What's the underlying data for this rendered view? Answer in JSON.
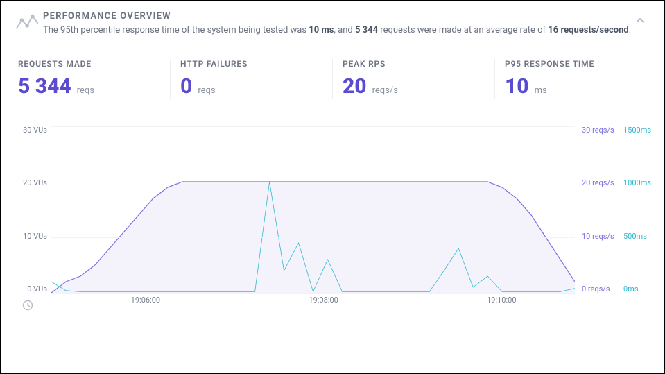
{
  "header": {
    "title": "PERFORMANCE OVERVIEW",
    "subtitle_prefix": "The 95th percentile response time of the system being tested was ",
    "p95_inline": "10 ms",
    "subtitle_mid": ", and ",
    "reqs_inline": "5 344",
    "subtitle_tail": " requests were made at an average rate of ",
    "rate_inline": "16 requests/second",
    "subtitle_end": "."
  },
  "stats": {
    "requests_made": {
      "label": "REQUESTS MADE",
      "value": "5 344",
      "unit": "reqs"
    },
    "http_failures": {
      "label": "HTTP FAILURES",
      "value": "0",
      "unit": "reqs"
    },
    "peak_rps": {
      "label": "PEAK RPS",
      "value": "20",
      "unit": "reqs/s"
    },
    "p95": {
      "label": "P95 RESPONSE TIME",
      "value": "10",
      "unit": "ms"
    }
  },
  "chart_data": {
    "type": "line",
    "title": "",
    "x": [
      "19:05:00",
      "19:05:10",
      "19:05:20",
      "19:05:30",
      "19:05:40",
      "19:05:50",
      "19:06:00",
      "19:06:10",
      "19:06:20",
      "19:06:30",
      "19:06:40",
      "19:06:50",
      "19:07:00",
      "19:07:10",
      "19:07:20",
      "19:07:30",
      "19:07:40",
      "19:07:50",
      "19:08:00",
      "19:08:10",
      "19:08:20",
      "19:08:30",
      "19:08:40",
      "19:08:50",
      "19:09:00",
      "19:09:10",
      "19:09:20",
      "19:09:30",
      "19:09:40",
      "19:09:50",
      "19:10:00",
      "19:10:10",
      "19:10:20",
      "19:10:30",
      "19:10:40",
      "19:10:50",
      "19:11:00"
    ],
    "series": [
      {
        "name": "VUs",
        "axis": "left",
        "unit": "VUs",
        "color": "#7a6fe0",
        "values": [
          0,
          2,
          3,
          5,
          8,
          11,
          14,
          17,
          19,
          20,
          20,
          20,
          20,
          20,
          20,
          20,
          20,
          20,
          20,
          20,
          20,
          20,
          20,
          20,
          20,
          20,
          20,
          20,
          20,
          20,
          20,
          19,
          17,
          14,
          10,
          6,
          2
        ]
      },
      {
        "name": "Request rate",
        "axis": "right1",
        "unit": "reqs/s",
        "color": "#7a6fe0",
        "values": [
          0,
          2,
          3,
          5,
          8,
          11,
          14,
          17,
          19,
          20,
          20,
          20,
          20,
          20,
          20,
          20,
          20,
          20,
          20,
          20,
          20,
          20,
          20,
          20,
          20,
          20,
          20,
          20,
          20,
          20,
          20,
          19,
          17,
          14,
          10,
          6,
          2
        ]
      },
      {
        "name": "Response time",
        "axis": "right2",
        "unit": "ms",
        "color": "#2fb8ce",
        "values": [
          100,
          20,
          10,
          10,
          10,
          10,
          10,
          10,
          10,
          10,
          10,
          10,
          10,
          10,
          10,
          1000,
          200,
          450,
          10,
          300,
          10,
          10,
          10,
          10,
          10,
          10,
          10,
          200,
          400,
          50,
          150,
          10,
          10,
          10,
          10,
          10,
          40
        ]
      }
    ],
    "y_axes": {
      "left": {
        "label": "VUs",
        "ticks": [
          0,
          10,
          20,
          30
        ],
        "tick_labels": [
          "0 VUs",
          "10 VUs",
          "20 VUs",
          "30 VUs"
        ]
      },
      "right1": {
        "label": "reqs/s",
        "ticks": [
          0,
          10,
          20,
          30
        ],
        "tick_labels": [
          "0 reqs/s",
          "10 reqs/s",
          "20 reqs/s",
          "30 reqs/s"
        ]
      },
      "right2": {
        "label": "ms",
        "ticks": [
          0,
          500,
          1000,
          1500
        ],
        "tick_labels": [
          "0ms",
          "500ms",
          "1000ms",
          "1500ms"
        ]
      }
    },
    "x_ticks": [
      "19:06:00",
      "19:08:00",
      "19:10:00"
    ],
    "x_tick_positions_pct": [
      18,
      52,
      86
    ],
    "xlabel": "",
    "ylabel": ""
  }
}
